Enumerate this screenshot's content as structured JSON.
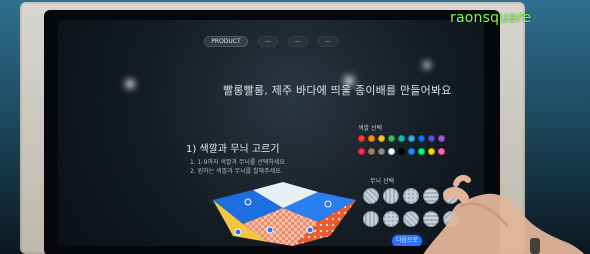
{
  "brand": {
    "logo_text": "raonsquare"
  },
  "screen": {
    "tabs": [
      {
        "label": "PRODUCT"
      },
      {
        "label": "—"
      },
      {
        "label": "—"
      },
      {
        "label": "—"
      }
    ],
    "title": "빨롱빨롱, 제주 바다에 띄울 종이배를 만들어봐요",
    "section_heading": "1) 색깔과 무늬 고르기",
    "instructions": [
      "1. 1-9까지 색깔과 무늬를 선택하세요.",
      "2. 원하는 색깔과 무늬를 칠해주세요."
    ],
    "palette_label": "색깔 선택",
    "pattern_label": "무늬 선택",
    "next_button": "다음으로"
  },
  "colors": {
    "palette": [
      "#ff3b30",
      "#ff9500",
      "#ffcc00",
      "#34c759",
      "#00c7be",
      "#32ade6",
      "#007aff",
      "#5856d6",
      "#af52de",
      "#ff2d55",
      "#a2845e",
      "#8e8e93",
      "#ffffff",
      "#000000",
      "#1e90ff",
      "#00ff7f",
      "#ffd700",
      "#ff69b4"
    ],
    "accent": "#2a72ff",
    "logo_green": "#7dff4a"
  }
}
